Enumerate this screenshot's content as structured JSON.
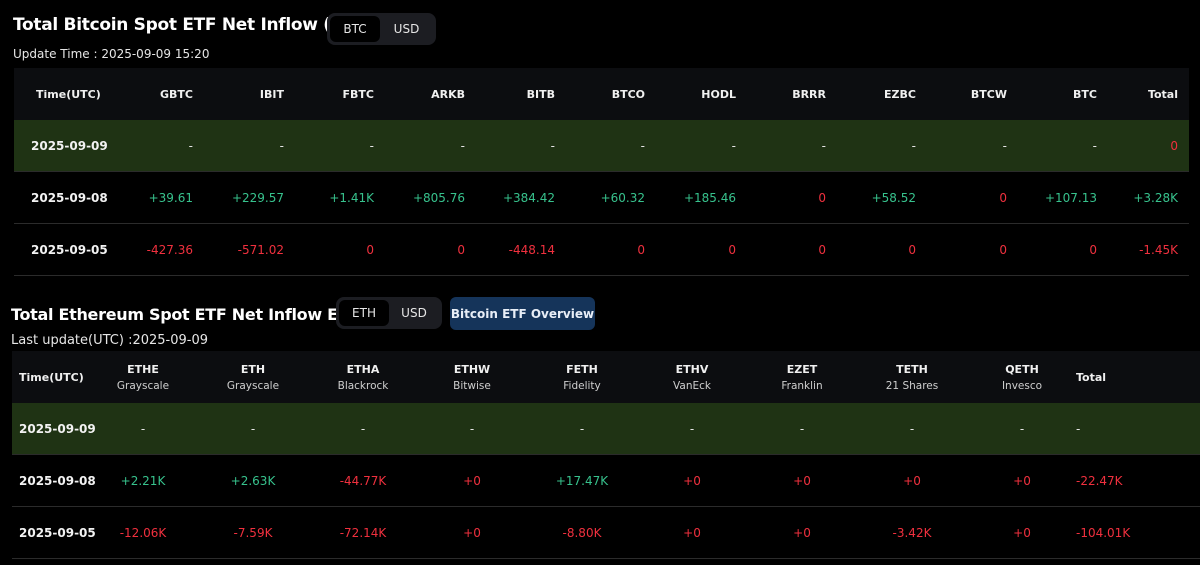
{
  "btc_section": {
    "title": "Total Bitcoin Spot ETF Net Inflow (BTC)",
    "toggle": [
      "BTC",
      "USD"
    ],
    "active": 0,
    "update_time": "Update Time : 2025-09-09 15:20",
    "columns": [
      "Time(UTC)",
      "GBTC",
      "IBIT",
      "FBTC",
      "ARKB",
      "BITB",
      "BTCO",
      "HODL",
      "BRRR",
      "EZBC",
      "BTCW",
      "BTC",
      "Total"
    ],
    "rows": [
      {
        "date": "2025-09-09",
        "cells": [
          {
            "v": "-",
            "s": "neu"
          },
          {
            "v": "-",
            "s": "neu"
          },
          {
            "v": "-",
            "s": "neu"
          },
          {
            "v": "-",
            "s": "neu"
          },
          {
            "v": "-",
            "s": "neu"
          },
          {
            "v": "-",
            "s": "neu"
          },
          {
            "v": "-",
            "s": "neu"
          },
          {
            "v": "-",
            "s": "neu"
          },
          {
            "v": "-",
            "s": "neu"
          },
          {
            "v": "-",
            "s": "neu"
          },
          {
            "v": "-",
            "s": "neu"
          },
          {
            "v": "0",
            "s": "neg"
          }
        ]
      },
      {
        "date": "2025-09-08",
        "cells": [
          {
            "v": "+39.61",
            "s": "pos"
          },
          {
            "v": "+229.57",
            "s": "pos"
          },
          {
            "v": "+1.41K",
            "s": "pos"
          },
          {
            "v": "+805.76",
            "s": "pos"
          },
          {
            "v": "+384.42",
            "s": "pos"
          },
          {
            "v": "+60.32",
            "s": "pos"
          },
          {
            "v": "+185.46",
            "s": "pos"
          },
          {
            "v": "0",
            "s": "neg"
          },
          {
            "v": "+58.52",
            "s": "pos"
          },
          {
            "v": "0",
            "s": "neg"
          },
          {
            "v": "+107.13",
            "s": "pos"
          },
          {
            "v": "+3.28K",
            "s": "pos"
          }
        ]
      },
      {
        "date": "2025-09-05",
        "cells": [
          {
            "v": "-427.36",
            "s": "neg"
          },
          {
            "v": "-571.02",
            "s": "neg"
          },
          {
            "v": "0",
            "s": "neg"
          },
          {
            "v": "0",
            "s": "neg"
          },
          {
            "v": "-448.14",
            "s": "neg"
          },
          {
            "v": "0",
            "s": "neg"
          },
          {
            "v": "0",
            "s": "neg"
          },
          {
            "v": "0",
            "s": "neg"
          },
          {
            "v": "0",
            "s": "neg"
          },
          {
            "v": "0",
            "s": "neg"
          },
          {
            "v": "0",
            "s": "neg"
          },
          {
            "v": "-1.45K",
            "s": "neg"
          }
        ]
      }
    ]
  },
  "eth_section": {
    "title": "Total Ethereum Spot ETF Net Inflow ETH",
    "toggle": [
      "ETH",
      "USD"
    ],
    "active": 0,
    "overview_button": "Bitcoin ETF Overview",
    "update_time": "Last update(UTC) :2025-09-09",
    "columns": [
      {
        "t": "Time(UTC)",
        "s": ""
      },
      {
        "t": "ETHE",
        "s": "Grayscale"
      },
      {
        "t": "ETH",
        "s": "Grayscale"
      },
      {
        "t": "ETHA",
        "s": "Blackrock"
      },
      {
        "t": "ETHW",
        "s": "Bitwise"
      },
      {
        "t": "FETH",
        "s": "Fidelity"
      },
      {
        "t": "ETHV",
        "s": "VanEck"
      },
      {
        "t": "EZET",
        "s": "Franklin"
      },
      {
        "t": "TETH",
        "s": "21 Shares"
      },
      {
        "t": "QETH",
        "s": "Invesco"
      },
      {
        "t": "Total",
        "s": ""
      }
    ],
    "rows": [
      {
        "date": "2025-09-09",
        "cells": [
          {
            "v": "-",
            "s": "neu"
          },
          {
            "v": "-",
            "s": "neu"
          },
          {
            "v": "-",
            "s": "neu"
          },
          {
            "v": "-",
            "s": "neu"
          },
          {
            "v": "-",
            "s": "neu"
          },
          {
            "v": "-",
            "s": "neu"
          },
          {
            "v": "-",
            "s": "neu"
          },
          {
            "v": "-",
            "s": "neu"
          },
          {
            "v": "-",
            "s": "neu"
          },
          {
            "v": "-",
            "s": "neu"
          }
        ]
      },
      {
        "date": "2025-09-08",
        "cells": [
          {
            "v": "+2.21K",
            "s": "pos"
          },
          {
            "v": "+2.63K",
            "s": "pos"
          },
          {
            "v": "-44.77K",
            "s": "neg"
          },
          {
            "v": "+0",
            "s": "neg"
          },
          {
            "v": "+17.47K",
            "s": "pos"
          },
          {
            "v": "+0",
            "s": "neg"
          },
          {
            "v": "+0",
            "s": "neg"
          },
          {
            "v": "+0",
            "s": "neg"
          },
          {
            "v": "+0",
            "s": "neg"
          },
          {
            "v": "-22.47K",
            "s": "neg"
          }
        ]
      },
      {
        "date": "2025-09-05",
        "cells": [
          {
            "v": "-12.06K",
            "s": "neg"
          },
          {
            "v": "-7.59K",
            "s": "neg"
          },
          {
            "v": "-72.14K",
            "s": "neg"
          },
          {
            "v": "+0",
            "s": "neg"
          },
          {
            "v": "-8.80K",
            "s": "neg"
          },
          {
            "v": "+0",
            "s": "neg"
          },
          {
            "v": "+0",
            "s": "neg"
          },
          {
            "v": "-3.42K",
            "s": "neg"
          },
          {
            "v": "+0",
            "s": "neg"
          },
          {
            "v": "-104.01K",
            "s": "neg"
          }
        ]
      }
    ]
  }
}
